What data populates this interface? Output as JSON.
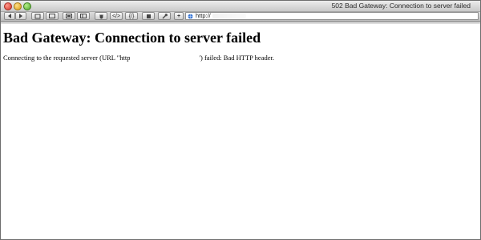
{
  "window": {
    "title": "502 Bad Gateway: Connection to server failed"
  },
  "toolbar": {
    "back_icon": "back-arrow-icon",
    "forward_icon": "forward-arrow-icon",
    "buttons": [
      {
        "name": "home-icon"
      },
      {
        "name": "window-icon"
      },
      {
        "name": "image-icon"
      },
      {
        "name": "sidebar-icon"
      },
      {
        "name": "bug-icon"
      },
      {
        "name": "code-icon"
      },
      {
        "name": "code-slash-icon"
      },
      {
        "name": "puzzle-icon"
      },
      {
        "name": "wrench-icon"
      },
      {
        "name": "add-icon"
      }
    ],
    "code_label": "</>",
    "code_slash_label": "{/}",
    "add_label": "+"
  },
  "address_bar": {
    "url": "http://"
  },
  "page": {
    "heading": "Bad Gateway: Connection to server failed",
    "message_prefix": "Connecting to the requested server (URL \"http",
    "message_suffix": "') failed: Bad HTTP header."
  }
}
